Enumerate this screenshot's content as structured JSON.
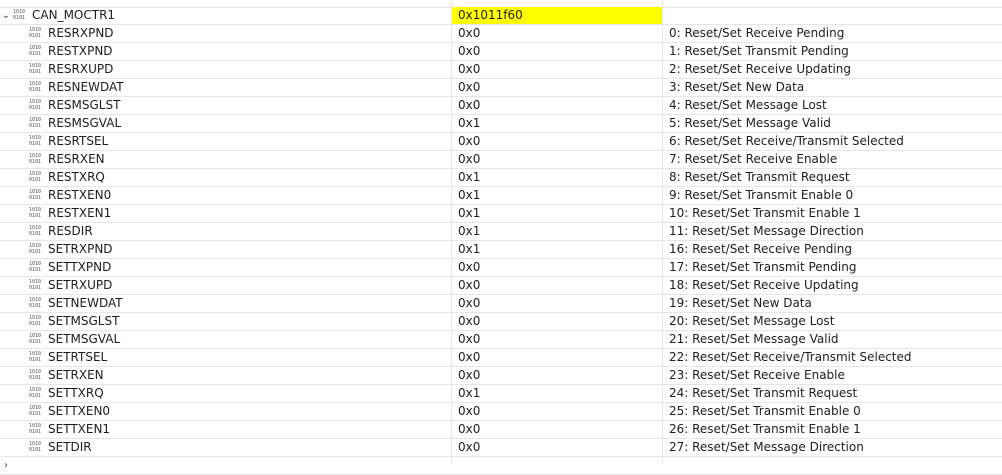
{
  "parent": {
    "name": "CAN_MOCTR1",
    "value": "0x1011f60"
  },
  "fields": [
    {
      "name": "RESRXPND",
      "value": "0x0",
      "desc": "0: Reset/Set Receive Pending"
    },
    {
      "name": "RESTXPND",
      "value": "0x0",
      "desc": "1: Reset/Set Transmit Pending"
    },
    {
      "name": "RESRXUPD",
      "value": "0x0",
      "desc": "2: Reset/Set Receive Updating"
    },
    {
      "name": "RESNEWDAT",
      "value": "0x0",
      "desc": "3: Reset/Set New Data"
    },
    {
      "name": "RESMSGLST",
      "value": "0x0",
      "desc": "4: Reset/Set Message Lost"
    },
    {
      "name": "RESMSGVAL",
      "value": "0x1",
      "desc": "5: Reset/Set Message Valid"
    },
    {
      "name": "RESRTSEL",
      "value": "0x0",
      "desc": "6: Reset/Set Receive/Transmit Selected"
    },
    {
      "name": "RESRXEN",
      "value": "0x0",
      "desc": "7: Reset/Set Receive Enable"
    },
    {
      "name": "RESTXRQ",
      "value": "0x1",
      "desc": "8: Reset/Set Transmit Request"
    },
    {
      "name": "RESTXEN0",
      "value": "0x1",
      "desc": "9: Reset/Set Transmit Enable 0"
    },
    {
      "name": "RESTXEN1",
      "value": "0x1",
      "desc": "10: Reset/Set Transmit Enable 1"
    },
    {
      "name": "RESDIR",
      "value": "0x1",
      "desc": "11: Reset/Set Message Direction"
    },
    {
      "name": "SETRXPND",
      "value": "0x1",
      "desc": "16: Reset/Set Receive Pending"
    },
    {
      "name": "SETTXPND",
      "value": "0x0",
      "desc": "17: Reset/Set Transmit Pending"
    },
    {
      "name": "SETRXUPD",
      "value": "0x0",
      "desc": "18: Reset/Set Receive Updating"
    },
    {
      "name": "SETNEWDAT",
      "value": "0x0",
      "desc": "19: Reset/Set New Data"
    },
    {
      "name": "SETMSGLST",
      "value": "0x0",
      "desc": "20: Reset/Set Message Lost"
    },
    {
      "name": "SETMSGVAL",
      "value": "0x0",
      "desc": "21: Reset/Set Message Valid"
    },
    {
      "name": "SETRTSEL",
      "value": "0x0",
      "desc": "22: Reset/Set Receive/Transmit Selected"
    },
    {
      "name": "SETRXEN",
      "value": "0x0",
      "desc": "23: Reset/Set Receive Enable"
    },
    {
      "name": "SETTXRQ",
      "value": "0x1",
      "desc": "24: Reset/Set Transmit Request"
    },
    {
      "name": "SETTXEN0",
      "value": "0x0",
      "desc": "25: Reset/Set Transmit Enable 0"
    },
    {
      "name": "SETTXEN1",
      "value": "0x0",
      "desc": "26: Reset/Set Transmit Enable 1"
    },
    {
      "name": "SETDIR",
      "value": "0x0",
      "desc": "27: Reset/Set Message Direction"
    }
  ],
  "icon": {
    "name": "binary-register-icon",
    "glyph_top": "1010",
    "glyph_bottom": "0101"
  },
  "colors": {
    "highlight": "#ffff00",
    "grid": "#e6e6e6"
  }
}
